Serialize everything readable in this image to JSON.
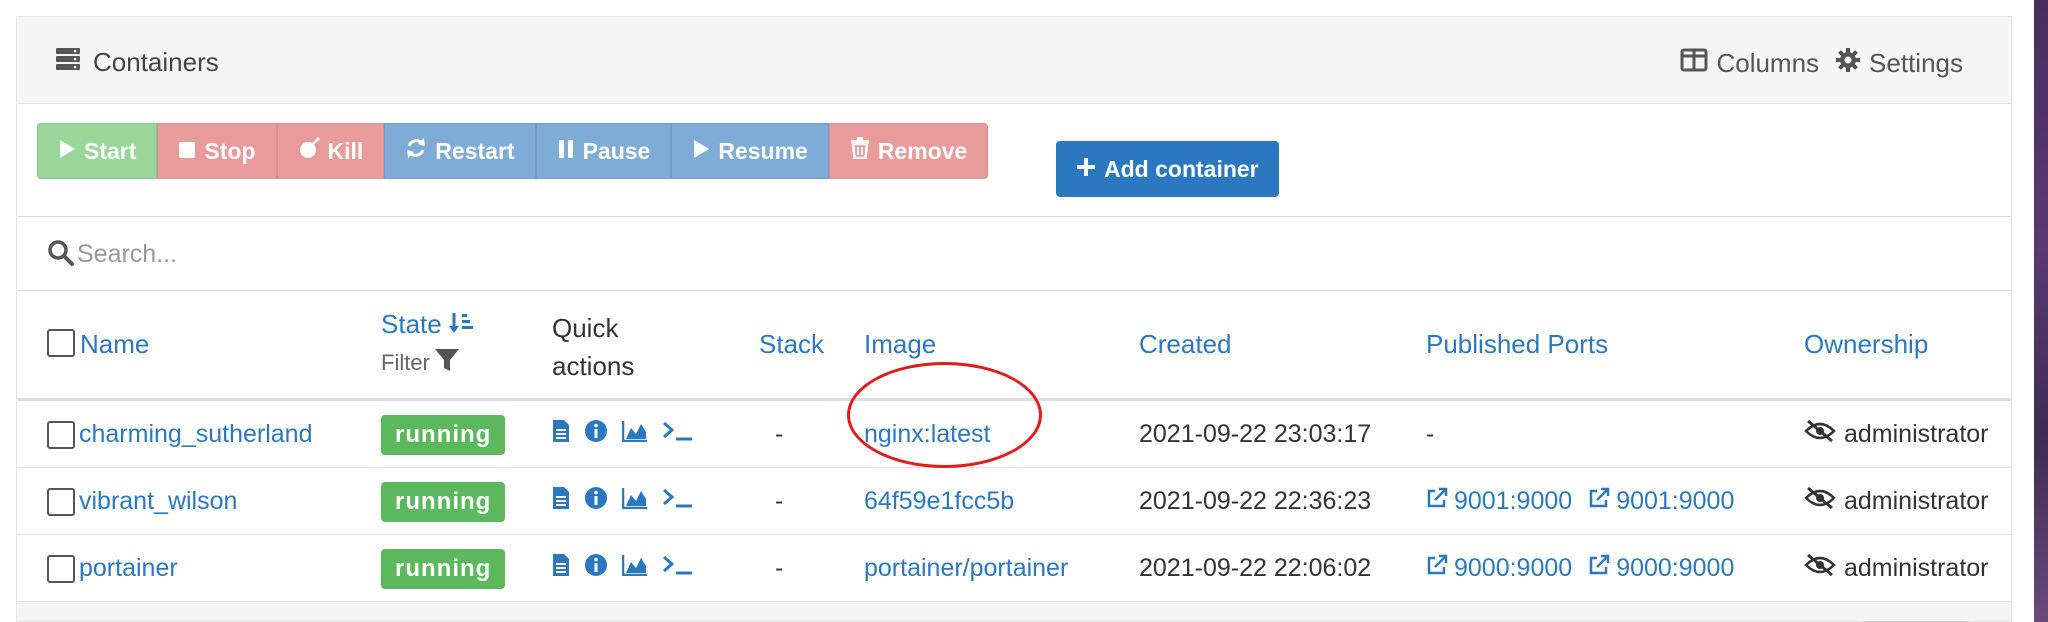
{
  "panel": {
    "title": "Containers",
    "columns_label": "Columns",
    "settings_label": "Settings"
  },
  "toolbar": {
    "start": "Start",
    "stop": "Stop",
    "kill": "Kill",
    "restart": "Restart",
    "pause": "Pause",
    "resume": "Resume",
    "remove": "Remove",
    "add_container": "Add container"
  },
  "search": {
    "placeholder": "Search..."
  },
  "table": {
    "headers": {
      "name": "Name",
      "state": "State",
      "state_filter": "Filter",
      "quick_actions_1": "Quick",
      "quick_actions_2": "actions",
      "stack": "Stack",
      "image": "Image",
      "created": "Created",
      "published_ports": "Published Ports",
      "ownership": "Ownership"
    },
    "rows": [
      {
        "name": "charming_sutherland",
        "state": "running",
        "stack": "-",
        "image": "nginx:latest",
        "created": "2021-09-22 23:03:17",
        "ports_text": "-",
        "ownership": "administrator"
      },
      {
        "name": "vibrant_wilson",
        "state": "running",
        "stack": "-",
        "image": "64f59e1fcc5b",
        "created": "2021-09-22 22:36:23",
        "ports": [
          "9001:9000",
          "9001:9000"
        ],
        "ownership": "administrator"
      },
      {
        "name": "portainer",
        "state": "running",
        "stack": "-",
        "image": "portainer/portainer",
        "created": "2021-09-22 22:06:02",
        "ports": [
          "9000:9000",
          "9000:9000"
        ],
        "ownership": "administrator"
      }
    ]
  },
  "colors": {
    "link": "#2c78c0",
    "running": "#5cb85c",
    "annotation": "#e21b1b"
  }
}
